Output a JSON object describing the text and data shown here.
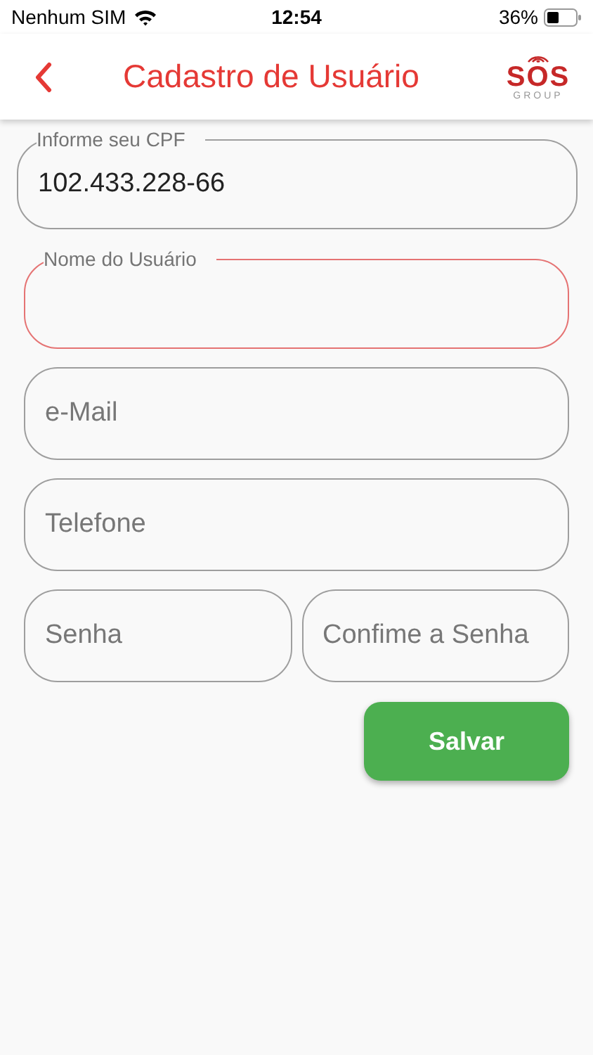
{
  "status_bar": {
    "carrier": "Nenhum SIM",
    "time": "12:54",
    "battery": "36%"
  },
  "header": {
    "title": "Cadastro de Usuário",
    "logo": {
      "text": "SOS",
      "subtitle": "GROUP"
    }
  },
  "form": {
    "rows": [
      {
        "fields": [
          {
            "label": "Informe seu CPF",
            "value": "102.433.228-66",
            "focused": false
          }
        ]
      },
      {
        "fields": [
          {
            "label": "Nome do Usuário",
            "focused": true
          }
        ]
      },
      {
        "fields": [
          {
            "placeholder": "e-Mail",
            "focused": false
          }
        ]
      },
      {
        "fields": [
          {
            "placeholder": "Telefone",
            "focused": false
          }
        ]
      },
      {
        "fields": [
          {
            "placeholder": "Senha",
            "focused": false
          },
          {
            "placeholder": "Confime a Senha",
            "focused": false
          }
        ]
      }
    ],
    "save_button": "Salvar"
  }
}
